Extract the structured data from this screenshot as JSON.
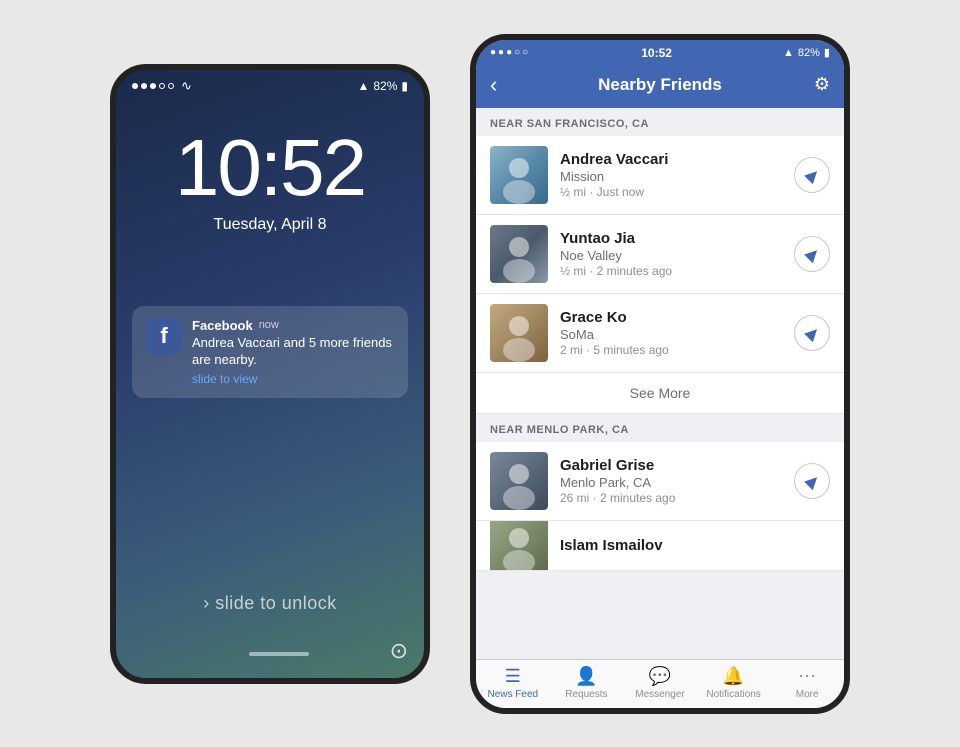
{
  "left_phone": {
    "status_bar": {
      "signal_dots": [
        "full",
        "full",
        "full",
        "empty",
        "empty"
      ],
      "wifi": "wifi",
      "location": "▲",
      "battery": "82%",
      "battery_icon": "🔋"
    },
    "time": "10:52",
    "date": "Tuesday, April 8",
    "notification": {
      "app": "Facebook",
      "time_label": "now",
      "body": "Andrea Vaccari and 5 more friends are nearby.",
      "slide_label": "slide to view"
    },
    "slide_unlock": "› slide to unlock"
  },
  "right_phone": {
    "status_bar": {
      "dots": "●●●○○",
      "time": "10:52",
      "location": "▲",
      "battery": "82%"
    },
    "nav": {
      "back_label": "‹",
      "title": "Nearby Friends",
      "gear_label": "⚙"
    },
    "sections": [
      {
        "header": "NEAR SAN FRANCISCO, CA",
        "friends": [
          {
            "name": "Andrea Vaccari",
            "location": "Mission",
            "distance": "½ mi · Just now",
            "avatar_class": "avatar-andrea"
          },
          {
            "name": "Yuntao Jia",
            "location": "Noe Valley",
            "distance": "½ mi · 2 minutes ago",
            "avatar_class": "avatar-yuntao"
          },
          {
            "name": "Grace Ko",
            "location": "SoMa",
            "distance": "2 mi · 5 minutes ago",
            "avatar_class": "avatar-grace"
          }
        ],
        "see_more": "See More"
      },
      {
        "header": "NEAR MENLO PARK, CA",
        "friends": [
          {
            "name": "Gabriel Grise",
            "location": "Menlo Park, CA",
            "distance": "26 mi · 2 minutes ago",
            "avatar_class": "avatar-gabriel"
          },
          {
            "name": "Islam Ismailov",
            "location": "",
            "distance": "",
            "avatar_class": "avatar-islam"
          }
        ],
        "see_more": null
      }
    ],
    "tab_bar": {
      "items": [
        {
          "icon": "≡",
          "label": "News Feed",
          "active": true
        },
        {
          "icon": "👤",
          "label": "Requests",
          "active": false
        },
        {
          "icon": "💬",
          "label": "Messenger",
          "active": false
        },
        {
          "icon": "🔔",
          "label": "Notifications",
          "active": false
        },
        {
          "icon": "≡",
          "label": "More",
          "active": false
        }
      ]
    }
  }
}
